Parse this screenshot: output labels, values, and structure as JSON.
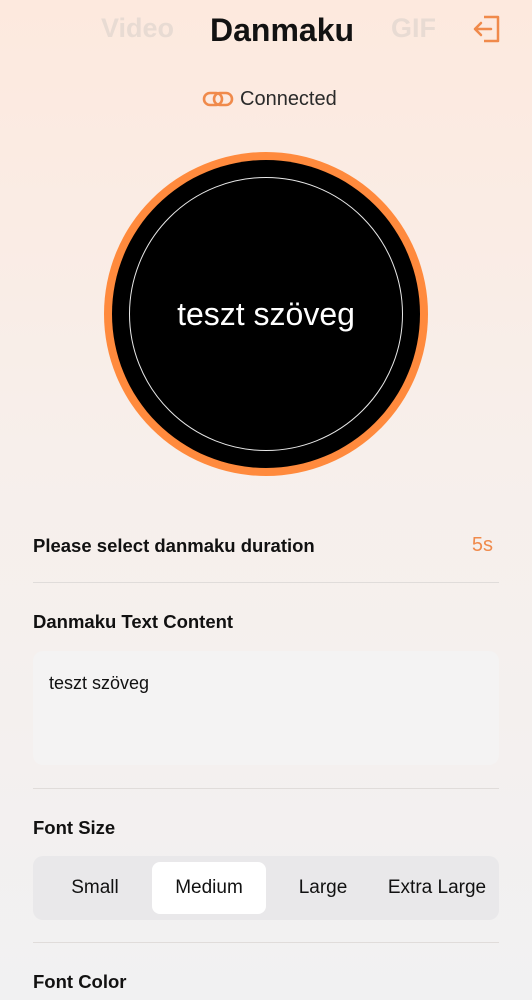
{
  "header": {
    "tabs": [
      "Video",
      "Danmaku",
      "GIF"
    ],
    "active_tab": "Danmaku",
    "exit_icon": "exit-icon"
  },
  "connection": {
    "icon": "link-icon",
    "status": "Connected",
    "accent": "#f08a4b"
  },
  "preview": {
    "text": "teszt szöveg",
    "ring_color": "#ff8a3d",
    "background": "#000000"
  },
  "duration": {
    "label": "Please select danmaku duration",
    "value": "5s"
  },
  "text_content": {
    "label": "Danmaku Text Content",
    "value": "teszt szöveg"
  },
  "font_size": {
    "label": "Font Size",
    "options": [
      "Small",
      "Medium",
      "Large",
      "Extra Large"
    ],
    "selected": "Medium"
  },
  "font_color": {
    "label": "Font Color"
  }
}
